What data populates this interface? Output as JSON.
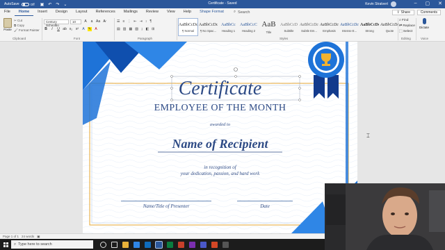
{
  "titlebar": {
    "autosave_label": "AutoSave",
    "autosave_state": "Off",
    "doc_title": "Certificate - Saved",
    "user_name": "Kevin Stratvert",
    "window_controls": [
      "minimize-icon",
      "restore-icon",
      "close-icon"
    ]
  },
  "tabs": [
    {
      "label": "File"
    },
    {
      "label": "Home"
    },
    {
      "label": "Insert"
    },
    {
      "label": "Design"
    },
    {
      "label": "Layout"
    },
    {
      "label": "References"
    },
    {
      "label": "Mailings"
    },
    {
      "label": "Review"
    },
    {
      "label": "View"
    },
    {
      "label": "Help"
    },
    {
      "label": "Shape Format"
    }
  ],
  "active_tab": "Home",
  "search_label": "Search",
  "share_label": "Share",
  "comments_label": "Comments",
  "ribbon": {
    "clipboard": {
      "paste": "Paste",
      "cut": "Cut",
      "copy": "Copy",
      "format_painter": "Format Painter",
      "group": "Clipboard"
    },
    "font": {
      "name": "Century Schoolbo",
      "size": "10",
      "group": "Font"
    },
    "paragraph": {
      "group": "Paragraph"
    },
    "styles": {
      "group": "Styles",
      "items": [
        {
          "sample": "AaBbCcDc",
          "name": "¶ Normal"
        },
        {
          "sample": "AaBbCcDc",
          "name": "¶ No Spac..."
        },
        {
          "sample": "AaBbCc",
          "name": "Heading 1"
        },
        {
          "sample": "AaBbCcC",
          "name": "Heading 2"
        },
        {
          "sample": "AaB",
          "name": "Title"
        },
        {
          "sample": "AaBbCcD",
          "name": "Subtitle"
        },
        {
          "sample": "AaBbCcDc",
          "name": "Subtle Em..."
        },
        {
          "sample": "AaBbCcDc",
          "name": "Emphasis"
        },
        {
          "sample": "AaBbCcDc",
          "name": "Intense E..."
        },
        {
          "sample": "AaBbCcDc",
          "name": "Strong"
        },
        {
          "sample": "AaBbCcDc",
          "name": "Quote"
        }
      ]
    },
    "editing": {
      "find": "Find",
      "replace": "Replace",
      "select": "Select",
      "group": "Editing"
    },
    "voice": {
      "dictate": "Dictate",
      "group": "Voice"
    }
  },
  "certificate": {
    "title": "Certificate",
    "subtitle": "EMPLOYEE OF THE MONTH",
    "awarded": "awarded to",
    "recipient": "Name of Recipient",
    "recognition": "in recognition of",
    "dedication": "your dedication, passion, and hard work",
    "presenter_label": "Name/Title of Presenter",
    "date_label": "Date"
  },
  "status": {
    "page": "Page 1 of 1",
    "words": "24 words"
  },
  "taskbar": {
    "search_placeholder": "Type here to search"
  },
  "colors": {
    "brand": "#2b579a",
    "cert_blue": "#2d4a85",
    "accent_blue": "#1e73d8",
    "gold": "#e6a532"
  }
}
